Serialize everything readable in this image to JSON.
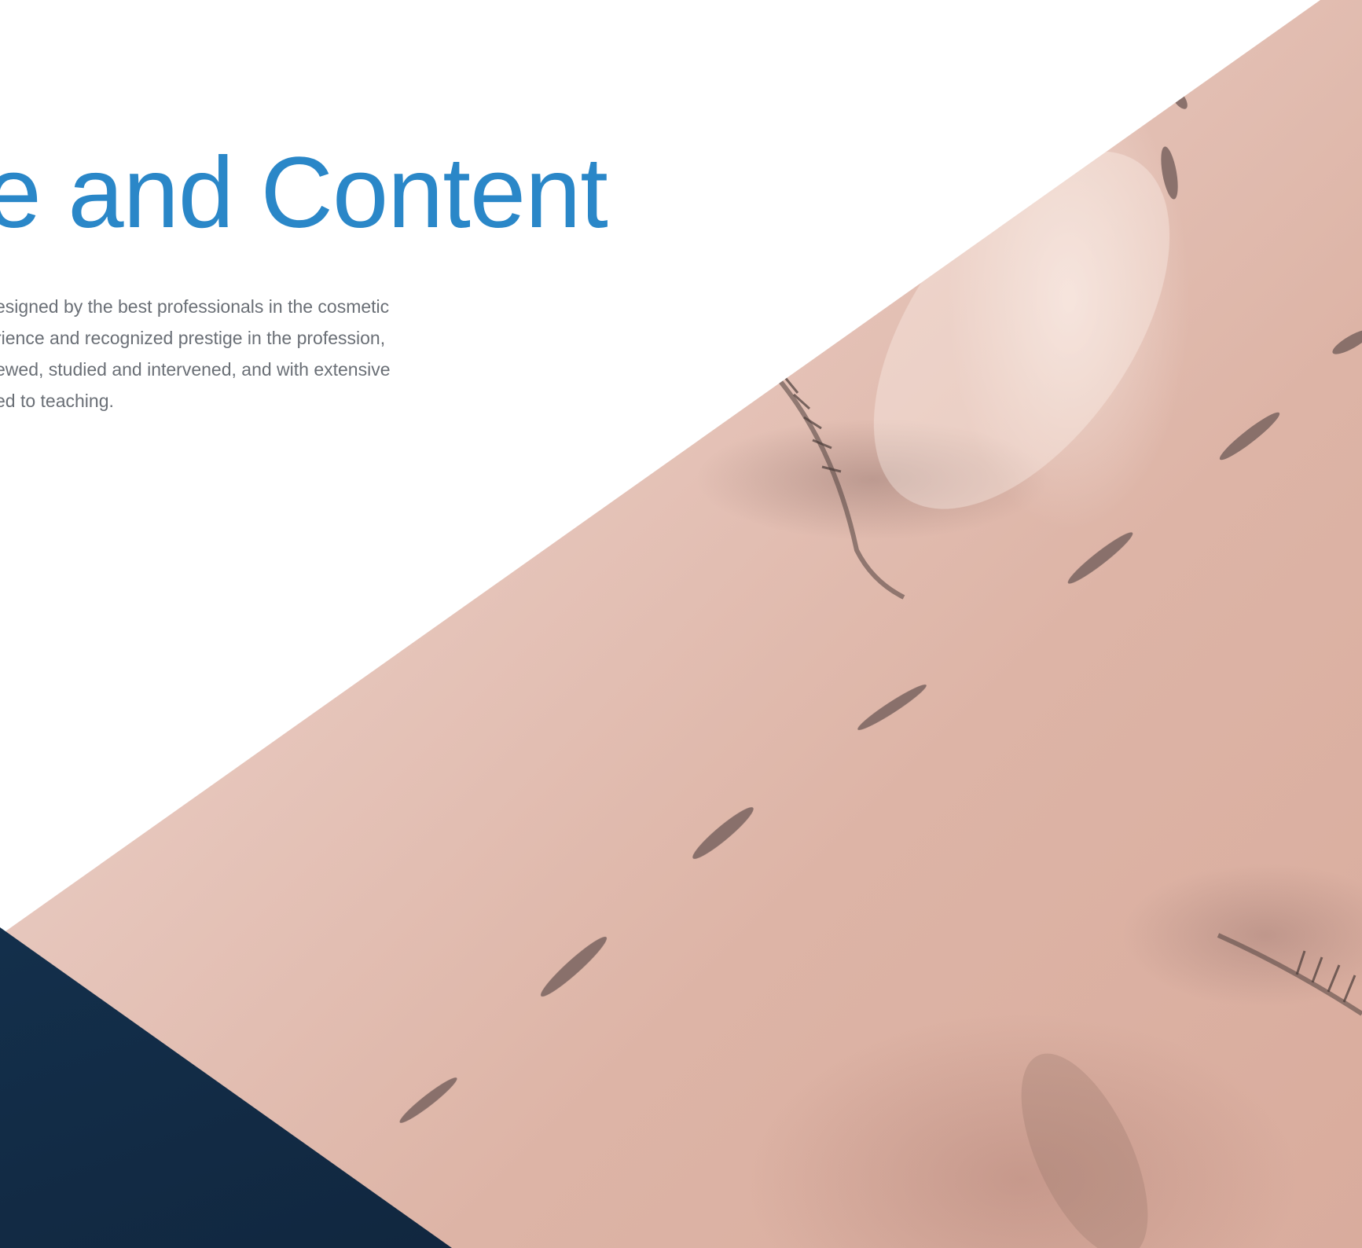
{
  "section": {
    "heading": "re and Content",
    "description_lines": [
      "esigned by the best professionals in the cosmetic",
      "rience and recognized prestige in the profession,",
      "ewed, studied and intervened, and with extensive",
      "ed to teaching."
    ]
  },
  "colors": {
    "heading": "#2a87c8",
    "body_text": "#6a6f76",
    "dark_panel": "#14324f",
    "skin_tone": "#e2bcb0"
  },
  "media": {
    "photo": "face-closeup-with-surgical-markings"
  }
}
